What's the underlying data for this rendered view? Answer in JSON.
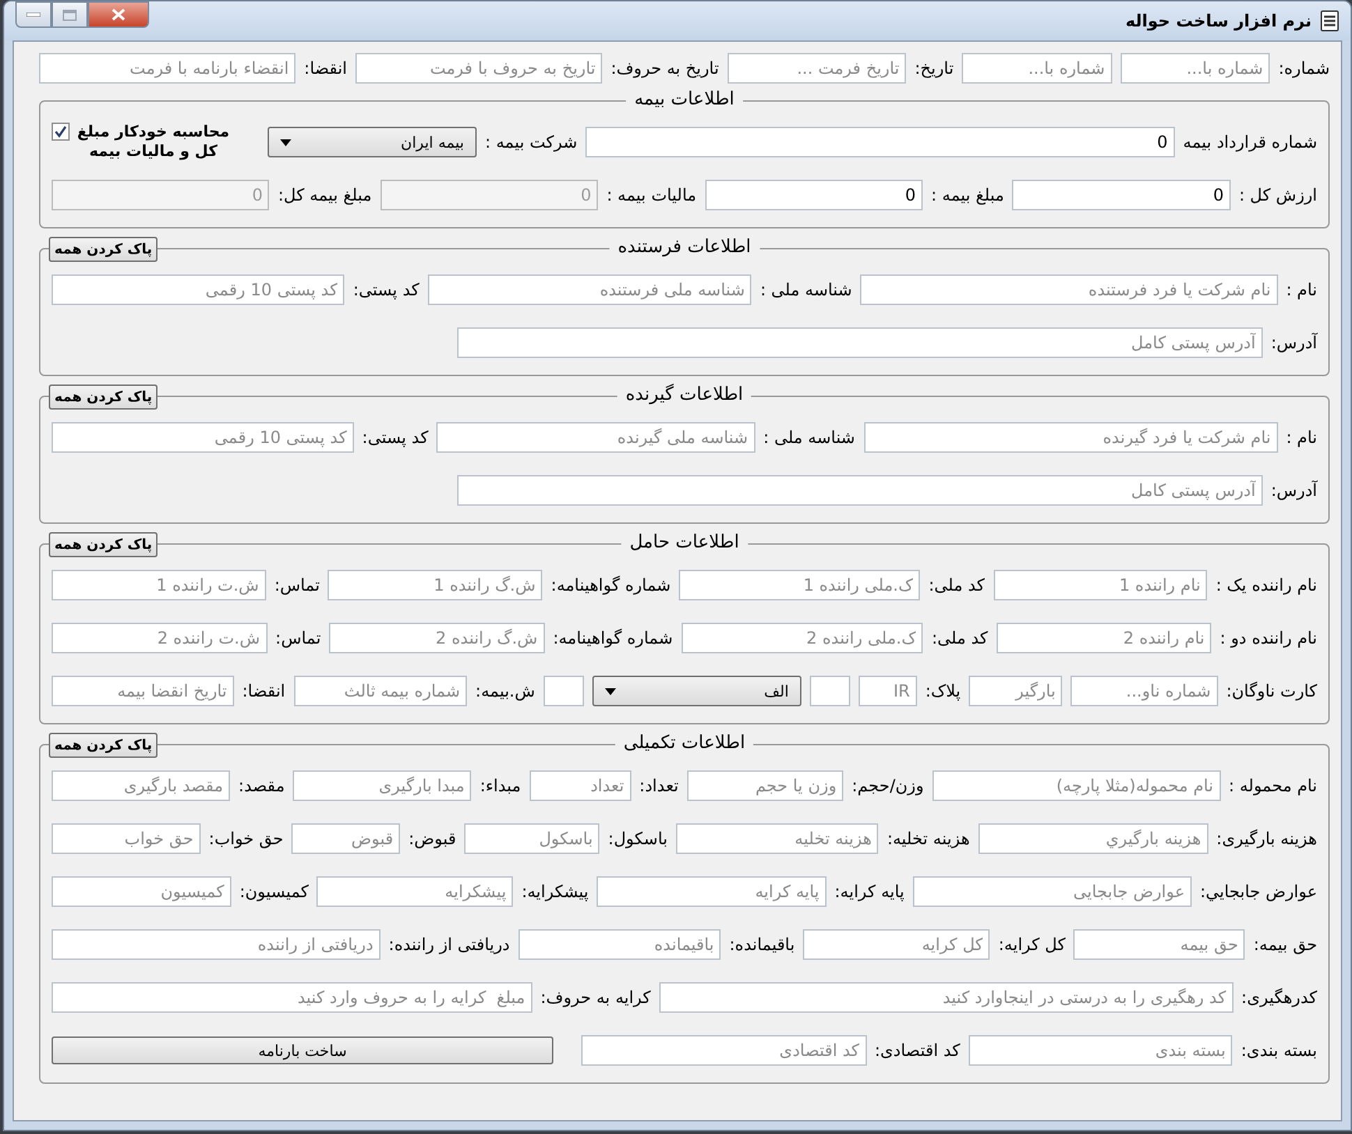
{
  "window": {
    "title": "نرم افزار ساخت حواله"
  },
  "top_row": [
    {
      "kind": "label",
      "text": "شماره:"
    },
    {
      "kind": "field",
      "placeholder": "شماره با..."
    },
    {
      "kind": "field",
      "placeholder": "شماره با..."
    },
    {
      "kind": "label",
      "text": "تاریخ:"
    },
    {
      "kind": "field",
      "placeholder": "تاریخ فرمت ..."
    },
    {
      "kind": "label",
      "text": "تاریخ به حروف:"
    },
    {
      "kind": "field",
      "placeholder": "تاریخ به حروف با فرمت"
    },
    {
      "kind": "label",
      "text": "انقضا:"
    },
    {
      "kind": "field",
      "placeholder": "انقضاء بارنامه با فرمت"
    }
  ],
  "groups": [
    {
      "title": "اطلاعات بیمه",
      "rows": [
        {
          "items": [
            {
              "kind": "label",
              "text": "شماره قرارداد بیمه"
            },
            {
              "kind": "field",
              "value": "0"
            },
            {
              "kind": "label",
              "text": "شرکت بیمه :"
            },
            {
              "kind": "select",
              "value": "بیمه ایران"
            },
            {
              "kind": "checkbox",
              "text": "محاسبه خودکار مبلغ کل و مالیات بیمه",
              "checked": true
            }
          ]
        },
        {
          "items": [
            {
              "kind": "label",
              "text": "ارزش کل :"
            },
            {
              "kind": "field",
              "value": "0",
              "disabled": false
            },
            {
              "kind": "label",
              "text": "مبلغ بیمه :"
            },
            {
              "kind": "field",
              "value": "0",
              "disabled": false
            },
            {
              "kind": "label",
              "text": "مالیات بیمه :"
            },
            {
              "kind": "field",
              "value": "0",
              "disabled": true
            },
            {
              "kind": "label",
              "text": "مبلغ بیمه کل:"
            },
            {
              "kind": "field",
              "value": "0",
              "disabled": true
            }
          ]
        }
      ]
    },
    {
      "title": "اطلاعات فرستنده",
      "clear_button": "پاک کردن همه",
      "rows": [
        {
          "items": [
            {
              "kind": "label",
              "text": "نام :"
            },
            {
              "kind": "field",
              "placeholder": "نام شرکت یا فرد فرستنده"
            },
            {
              "kind": "label",
              "text": "شناسه ملی :"
            },
            {
              "kind": "field",
              "placeholder": "شناسه ملی فرستنده"
            },
            {
              "kind": "label",
              "text": "کد پستی:"
            },
            {
              "kind": "field",
              "placeholder": "کد پستی 10 رقمی"
            }
          ]
        },
        {
          "items": [
            {
              "kind": "label",
              "text": "آدرس:"
            },
            {
              "kind": "field",
              "placeholder": "آدرس پستی کامل"
            }
          ]
        }
      ]
    },
    {
      "title": "اطلاعات گیرنده",
      "clear_button": "پاک کردن همه",
      "rows": [
        {
          "items": [
            {
              "kind": "label",
              "text": "نام :"
            },
            {
              "kind": "field",
              "placeholder": "نام شرکت یا فرد گیرنده"
            },
            {
              "kind": "label",
              "text": "شناسه ملی :"
            },
            {
              "kind": "field",
              "placeholder": "شناسه ملی گیرنده"
            },
            {
              "kind": "label",
              "text": "کد پستی:"
            },
            {
              "kind": "field",
              "placeholder": "کد پستی 10 رقمی"
            }
          ]
        },
        {
          "items": [
            {
              "kind": "label",
              "text": "آدرس:"
            },
            {
              "kind": "field",
              "placeholder": "آدرس پستی کامل"
            }
          ]
        }
      ]
    },
    {
      "title": "اطلاعات حامل",
      "clear_button": "پاک کردن همه",
      "rows": [
        {
          "items": [
            {
              "kind": "label",
              "text": "نام راننده یک :"
            },
            {
              "kind": "field",
              "placeholder": "نام راننده 1"
            },
            {
              "kind": "label",
              "text": "کد ملی:"
            },
            {
              "kind": "field",
              "placeholder": "ک.ملی راننده 1"
            },
            {
              "kind": "label",
              "text": "شماره گواهینامه:"
            },
            {
              "kind": "field",
              "placeholder": "ش.گ راننده 1"
            },
            {
              "kind": "label",
              "text": "تماس:"
            },
            {
              "kind": "field",
              "placeholder": "ش.ت راننده 1"
            }
          ]
        },
        {
          "items": [
            {
              "kind": "label",
              "text": "نام راننده دو :"
            },
            {
              "kind": "field",
              "placeholder": "نام راننده 2"
            },
            {
              "kind": "label",
              "text": "کد ملی:"
            },
            {
              "kind": "field",
              "placeholder": "ک.ملی راننده 2"
            },
            {
              "kind": "label",
              "text": "شماره گواهینامه:"
            },
            {
              "kind": "field",
              "placeholder": "ش.گ راننده 2"
            },
            {
              "kind": "label",
              "text": "تماس:"
            },
            {
              "kind": "field",
              "placeholder": "ش.ت راننده 2"
            }
          ]
        },
        {
          "items": [
            {
              "kind": "label",
              "text": "کارت ناوگان:"
            },
            {
              "kind": "field",
              "placeholder": "شماره ناو..."
            },
            {
              "kind": "field",
              "placeholder": "بارگیر"
            },
            {
              "kind": "label",
              "text": "پلاک:"
            },
            {
              "kind": "field",
              "placeholder": "IR"
            },
            {
              "kind": "field"
            },
            {
              "kind": "select",
              "value": "الف"
            },
            {
              "kind": "field"
            },
            {
              "kind": "label",
              "text": "ش.بیمه:"
            },
            {
              "kind": "field",
              "placeholder": "شماره بیمه ثالث"
            },
            {
              "kind": "label",
              "text": "انقضا:"
            },
            {
              "kind": "field",
              "placeholder": "تاریخ انقضا بیمه"
            }
          ]
        }
      ]
    },
    {
      "title": "اطلاعات تکمیلی",
      "clear_button": "پاک کردن همه",
      "rows": [
        {
          "items": [
            {
              "kind": "label",
              "text": "نام محموله :"
            },
            {
              "kind": "field",
              "placeholder": "نام محموله(مثلا پارچه)"
            },
            {
              "kind": "label",
              "text": "وزن/حجم:"
            },
            {
              "kind": "field",
              "placeholder": "وزن یا حجم"
            },
            {
              "kind": "label",
              "text": "تعداد:"
            },
            {
              "kind": "field",
              "placeholder": "تعداد"
            },
            {
              "kind": "label",
              "text": "مبداء:"
            },
            {
              "kind": "field",
              "placeholder": "مبدا بارگیری"
            },
            {
              "kind": "label",
              "text": "مقصد:"
            },
            {
              "kind": "field",
              "placeholder": "مقصد بارگیری"
            }
          ]
        },
        {
          "items": [
            {
              "kind": "label",
              "text": "هزینه بارگیری:"
            },
            {
              "kind": "field",
              "placeholder": "هزینه بارگیري"
            },
            {
              "kind": "label",
              "text": "هزینه تخلیه:"
            },
            {
              "kind": "field",
              "placeholder": "هزینه تخلیه"
            },
            {
              "kind": "label",
              "text": "باسکول:"
            },
            {
              "kind": "field",
              "placeholder": "باسکول"
            },
            {
              "kind": "label",
              "text": "قبوض:"
            },
            {
              "kind": "field",
              "placeholder": "قبوض"
            },
            {
              "kind": "label",
              "text": "حق خواب:"
            },
            {
              "kind": "field",
              "placeholder": "حق خواب"
            }
          ]
        },
        {
          "items": [
            {
              "kind": "label",
              "text": "عوارض جابجایي:"
            },
            {
              "kind": "field",
              "placeholder": "عوارض جابجایی"
            },
            {
              "kind": "label",
              "text": "پایه کرایه:"
            },
            {
              "kind": "field",
              "placeholder": "پایه کرایه"
            },
            {
              "kind": "label",
              "text": "پیشکرایه:"
            },
            {
              "kind": "field",
              "placeholder": "پیشکرایه"
            },
            {
              "kind": "label",
              "text": "کمیسیون:"
            },
            {
              "kind": "field",
              "placeholder": "کمیسیون"
            }
          ]
        },
        {
          "items": [
            {
              "kind": "label",
              "text": "حق بیمه:"
            },
            {
              "kind": "field",
              "placeholder": "حق بیمه"
            },
            {
              "kind": "label",
              "text": "کل کرایه:"
            },
            {
              "kind": "field",
              "placeholder": "کل کرایه"
            },
            {
              "kind": "label",
              "text": "باقیمانده:"
            },
            {
              "kind": "field",
              "placeholder": "باقیمانده"
            },
            {
              "kind": "label",
              "text": "دریافتی از راننده:"
            },
            {
              "kind": "field",
              "placeholder": "دریافتی از راننده"
            }
          ]
        },
        {
          "items": [
            {
              "kind": "label",
              "text": "کدرهگیری:"
            },
            {
              "kind": "field",
              "placeholder": "کد رهگیری را به درستی در اینجاوارد کنید"
            },
            {
              "kind": "label",
              "text": "کرایه به حروف:"
            },
            {
              "kind": "field",
              "placeholder": "مبلغ  کرایه را به حروف وارد کنید"
            }
          ]
        },
        {
          "items": [
            {
              "kind": "label",
              "text": "بسته بندی:"
            },
            {
              "kind": "field",
              "placeholder": "بسته بندی"
            },
            {
              "kind": "label",
              "text": "کد اقتصادی:"
            },
            {
              "kind": "field",
              "placeholder": "کد اقتصادی"
            },
            {
              "kind": "button",
              "text": "ساخت بارنامه"
            }
          ]
        }
      ]
    }
  ]
}
